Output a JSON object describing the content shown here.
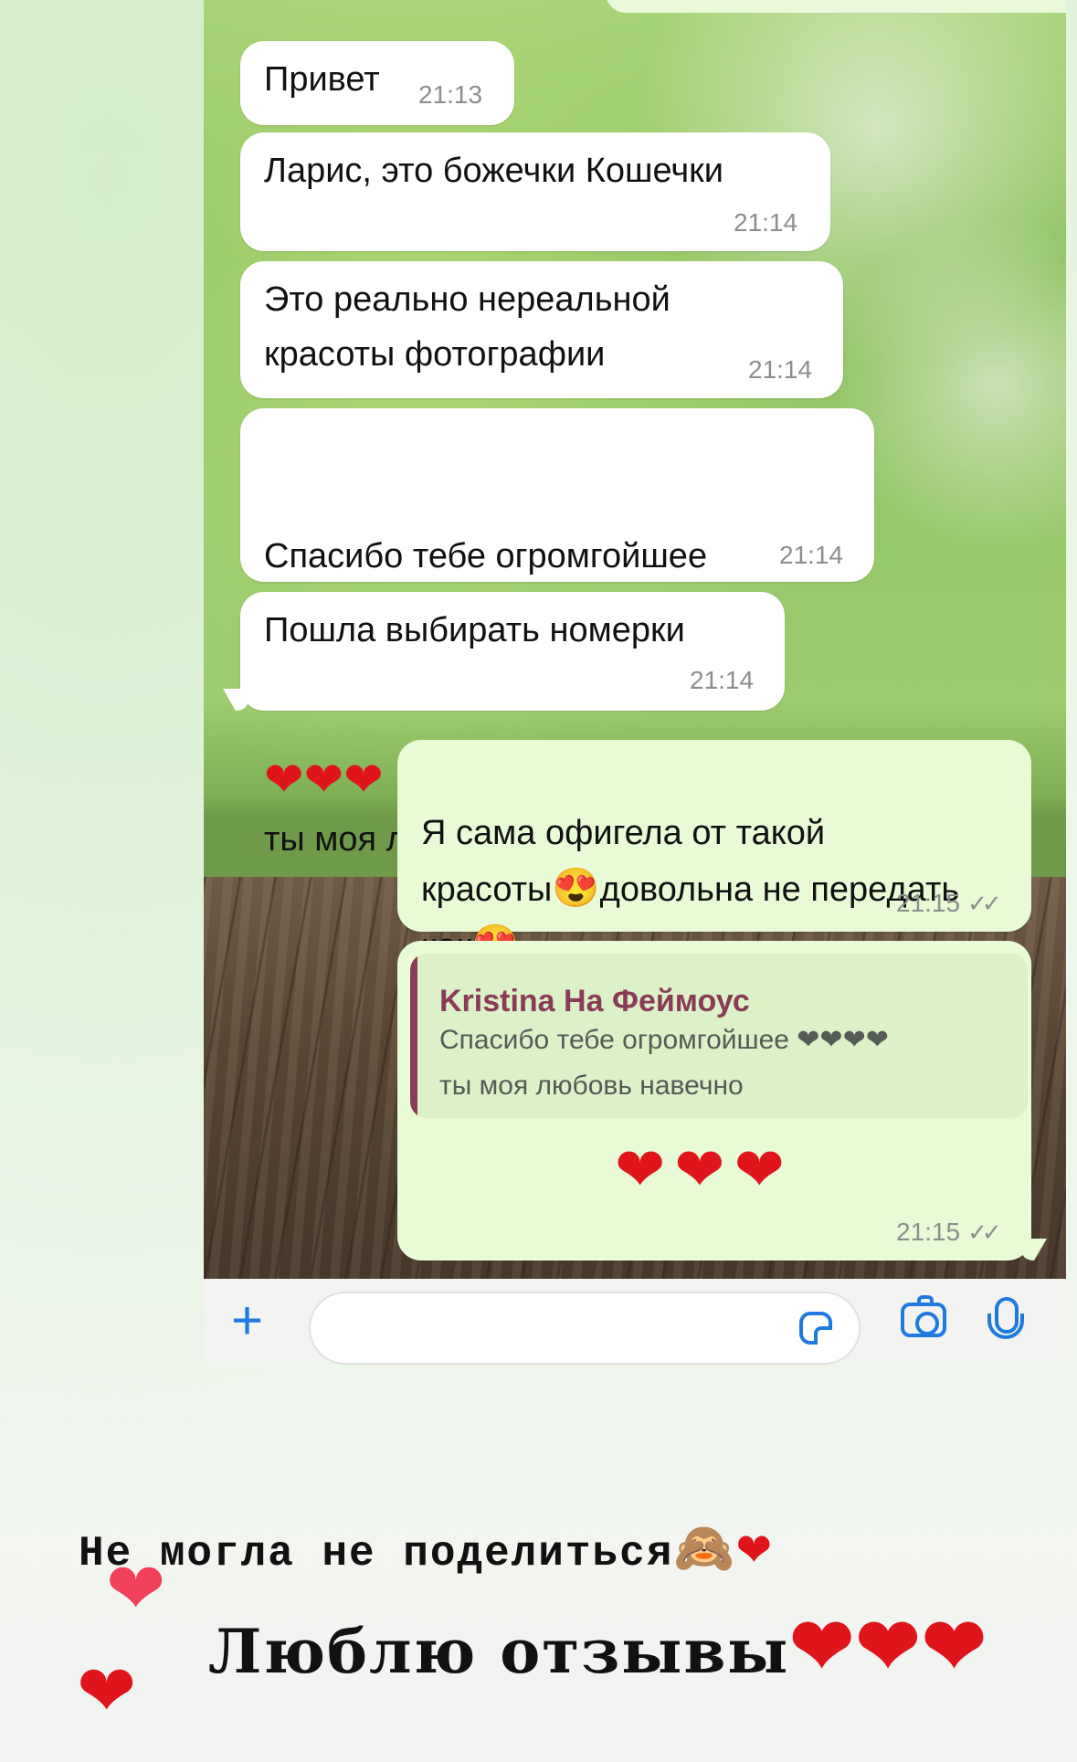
{
  "messages": [
    {
      "text": "Привет",
      "time": "21:13"
    },
    {
      "text": "Ларис, это божечки Кошечки",
      "time": "21:14"
    },
    {
      "text": "Это реально нереальной\nкрасоты фотографии",
      "time": "21:14"
    },
    {
      "line1": "Спасибо тебе огромгойшее",
      "line2": "ты моя любовь навечно",
      "hearts_inline": "❤",
      "hearts_lead": "❤❤❤",
      "time": "21:14"
    },
    {
      "text": "Пошла выбирать номерки",
      "time": "21:14"
    }
  ],
  "outgoing": [
    {
      "part1": "Я сама офигела от такой\nкрасоты",
      "emoji": "😍",
      "part2": "довольна не передать\nкак",
      "emoji2": "😍",
      "time": "21:15",
      "status": "✓✓"
    },
    {
      "reply_name": "Kristina На Феймоус",
      "reply_text": "Спасибо тебе огромгойшее ❤❤❤❤\nты моя любовь навечно",
      "body": "❤❤❤",
      "time": "21:15",
      "status": "✓✓"
    }
  ],
  "captions": {
    "line1": "Не могла не поделиться",
    "line1_emoji": "🙈",
    "line1_heart": "❤",
    "line2": "Люблю отзывы",
    "line2_hearts": "❤❤❤"
  },
  "icons": {
    "plus": "+",
    "sticker": "sticker-icon",
    "camera": "camera-icon",
    "mic": "microphone-icon"
  },
  "stickers": {
    "heart": "❤"
  },
  "colors": {
    "accent": "#1f7ae0",
    "heart": "#e0151c",
    "reply_name": "#8a3b56",
    "outgoing_bubble": "#e9fbd6"
  }
}
